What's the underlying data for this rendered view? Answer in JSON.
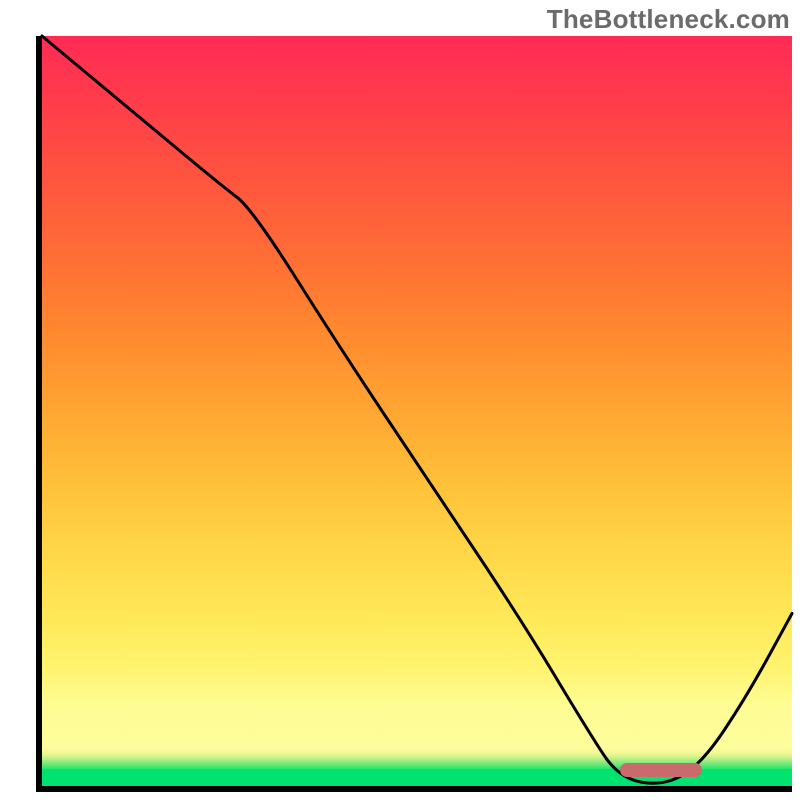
{
  "watermark": "TheBottleneck.com",
  "marker": {
    "color": "#c96b6d"
  },
  "chart_data": {
    "type": "line",
    "title": "",
    "xlabel": "",
    "ylabel": "",
    "xlim": [
      0,
      100
    ],
    "ylim": [
      0,
      100
    ],
    "grid": false,
    "legend": false,
    "x": [
      0,
      12,
      24,
      28,
      40,
      52,
      64,
      73,
      77,
      83,
      88,
      94,
      100
    ],
    "values": [
      100,
      90,
      80,
      77,
      58,
      40,
      22,
      7,
      1,
      0,
      3,
      12,
      23
    ],
    "optimal_range_x": [
      77,
      88
    ],
    "background_gradient_stops": [
      {
        "pos": 0.0,
        "color": "#00e36e"
      },
      {
        "pos": 0.05,
        "color": "#fdfd9c"
      },
      {
        "pos": 0.5,
        "color": "#ffa632"
      },
      {
        "pos": 1.0,
        "color": "#ff2b55"
      }
    ]
  }
}
